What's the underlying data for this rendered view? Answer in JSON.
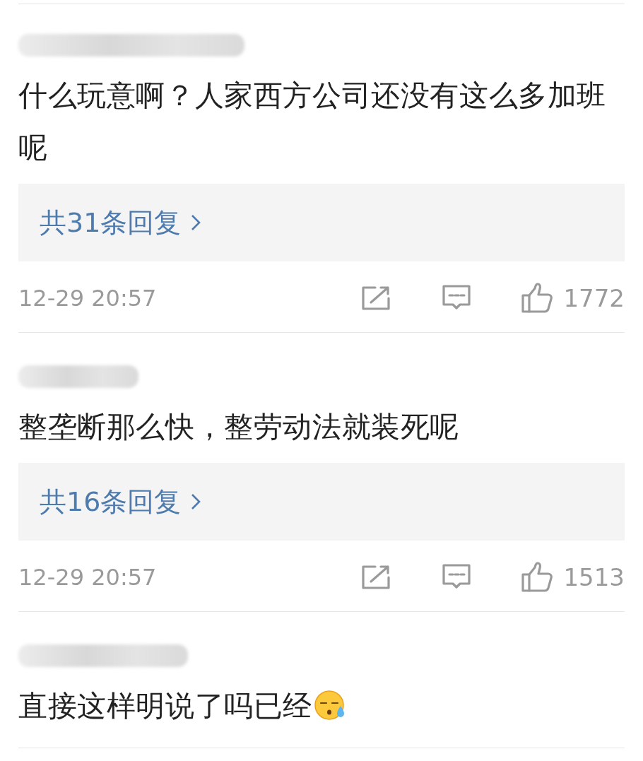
{
  "comments": [
    {
      "text": "什么玩意啊？人家西方公司还没有这么多加班呢",
      "trailing_emoji": false,
      "replies": "共31条回复",
      "time": "12-29 20:57",
      "likes": "1772"
    },
    {
      "text": "整垄断那么快，整劳动法就装死呢",
      "trailing_emoji": false,
      "replies": "共16条回复",
      "time": "12-29 20:57",
      "likes": "1513"
    },
    {
      "text": "直接这样明说了吗已经",
      "trailing_emoji": true
    }
  ]
}
